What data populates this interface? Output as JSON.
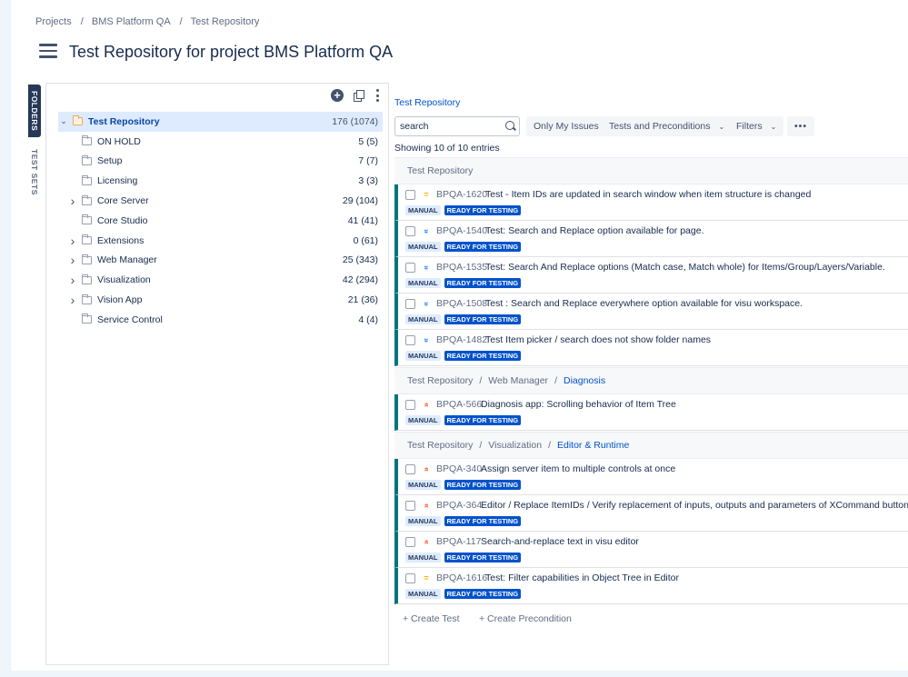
{
  "breadcrumb": [
    "Projects",
    "BMS Platform QA",
    "Test Repository"
  ],
  "page_title": "Test Repository for project BMS Platform QA",
  "vertical_tabs": {
    "folders": "FOLDERS",
    "test_sets": "TEST SETS"
  },
  "tree": {
    "root": {
      "label": "Test Repository",
      "count": "176 (1074)"
    },
    "items": [
      {
        "label": "ON HOLD",
        "count": "5 (5)",
        "expandable": false
      },
      {
        "label": "Setup",
        "count": "7 (7)",
        "expandable": false
      },
      {
        "label": "Licensing",
        "count": "3 (3)",
        "expandable": false
      },
      {
        "label": "Core Server",
        "count": "29 (104)",
        "expandable": true
      },
      {
        "label": "Core Studio",
        "count": "41 (41)",
        "expandable": false
      },
      {
        "label": "Extensions",
        "count": "0 (61)",
        "expandable": true
      },
      {
        "label": "Web Manager",
        "count": "25 (343)",
        "expandable": true
      },
      {
        "label": "Visualization",
        "count": "42 (294)",
        "expandable": true
      },
      {
        "label": "Vision App",
        "count": "21 (36)",
        "expandable": true
      },
      {
        "label": "Service Control",
        "count": "4 (4)",
        "expandable": false
      }
    ]
  },
  "right": {
    "breadcrumb": "Test Repository",
    "search_value": "search",
    "only_my_issues": "Only My Issues",
    "tests_and_preconditions": "Tests and Preconditions",
    "filters": "Filters",
    "more": "•••",
    "showing": "Showing 10 of 10 entries",
    "groups": [
      {
        "path": [
          "Test Repository"
        ],
        "items": [
          {
            "priority": "medium",
            "key": "BPQA-1620",
            "summary": "Test - Item IDs are updated in search window when item structure is changed"
          },
          {
            "priority": "low",
            "key": "BPQA-1540",
            "summary": "Test: Search and Replace option available for page."
          },
          {
            "priority": "low",
            "key": "BPQA-1535",
            "summary": "Test: Search And Replace options (Match case, Match whole) for Items/Group/Layers/Variable."
          },
          {
            "priority": "low",
            "key": "BPQA-1508",
            "summary": "Test : Search and Replace everywhere option available for visu workspace."
          },
          {
            "priority": "low",
            "key": "BPQA-1482",
            "summary": "Test Item picker / search does not show folder names"
          }
        ]
      },
      {
        "path": [
          "Test Repository",
          "Web Manager",
          "Diagnosis"
        ],
        "items": [
          {
            "priority": "high",
            "key": "BPQA-566",
            "summary": "Diagnosis app: Scrolling behavior of Item Tree"
          }
        ]
      },
      {
        "path": [
          "Test Repository",
          "Visualization",
          "Editor & Runtime"
        ],
        "items": [
          {
            "priority": "high",
            "key": "BPQA-340",
            "summary": "Assign server item to multiple controls at once"
          },
          {
            "priority": "high",
            "key": "BPQA-364",
            "summary": "Editor / Replace ItemIDs / Verify replacement of inputs, outputs and parameters of XCommand buttons"
          },
          {
            "priority": "high",
            "key": "BPQA-117",
            "summary": "Search-and-replace text in visu editor"
          },
          {
            "priority": "medium",
            "key": "BPQA-1616",
            "summary": "Test: Filter capabilities in Object Tree in Editor"
          }
        ]
      }
    ],
    "label_manual": "MANUAL",
    "label_ready": "READY FOR TESTING",
    "create_test": "+ Create Test",
    "create_precondition": "+ Create Precondition"
  }
}
